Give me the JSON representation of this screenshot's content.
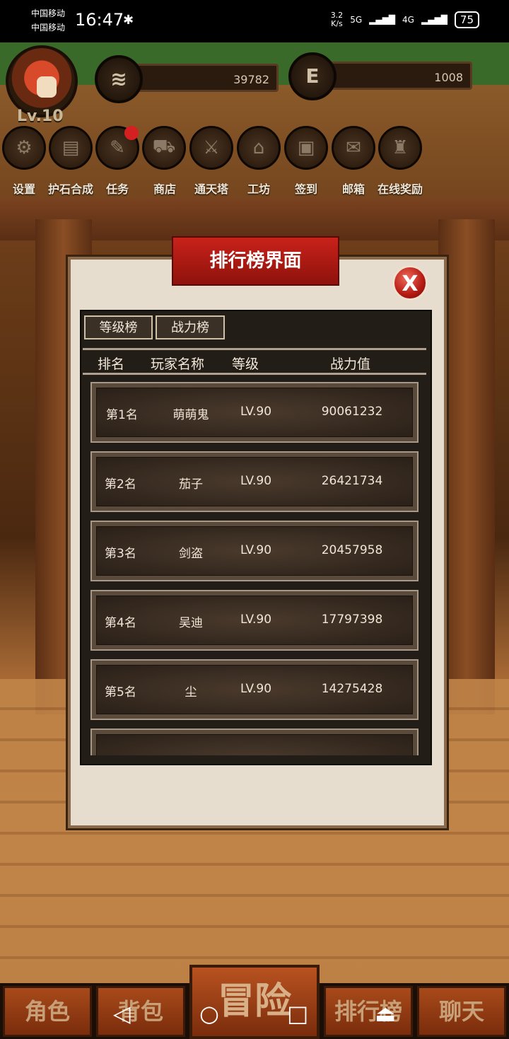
{
  "status_bar": {
    "carrier_1": "中国移动",
    "carrier_2": "中国移动",
    "time": "16:47",
    "net_speed_value": "3.2",
    "net_speed_unit": "K/s",
    "signal_1": "5G",
    "signal_2": "4G",
    "battery": "75"
  },
  "player": {
    "level": "Lv.10",
    "coins": "39782",
    "energy": "1008",
    "energy_icon": "E"
  },
  "menu": [
    {
      "label": "设置",
      "icon": "gear-icon"
    },
    {
      "label": "护石合成",
      "icon": "book-icon"
    },
    {
      "label": "任务",
      "icon": "scroll-icon"
    },
    {
      "label": "商店",
      "icon": "cart-icon"
    },
    {
      "label": "通天塔",
      "icon": "sword-icon"
    },
    {
      "label": "工坊",
      "icon": "house-icon"
    },
    {
      "label": "签到",
      "icon": "chest-icon"
    },
    {
      "label": "邮箱",
      "icon": "mail-icon"
    },
    {
      "label": "在线奖励",
      "icon": "bag-icon"
    }
  ],
  "dialog": {
    "title": "排行榜界面",
    "close_label": "X",
    "tabs": [
      "等级榜",
      "战力榜"
    ],
    "columns": [
      "排名",
      "玩家名称",
      "等级",
      "战力值"
    ],
    "rows": [
      {
        "rank": "第1名",
        "name": "萌萌鬼",
        "level": "LV.90",
        "power": "90061232"
      },
      {
        "rank": "第2名",
        "name": "茄子",
        "level": "LV.90",
        "power": "26421734"
      },
      {
        "rank": "第3名",
        "name": "剑盗",
        "level": "LV.90",
        "power": "20457958"
      },
      {
        "rank": "第4名",
        "name": "吴迪",
        "level": "LV.90",
        "power": "17797398"
      },
      {
        "rank": "第5名",
        "name": "尘",
        "level": "LV.90",
        "power": "14275428"
      }
    ]
  },
  "bottom_nav": {
    "role": "角色",
    "bag": "背包",
    "adventure": "冒险",
    "rank": "排行榜",
    "chat": "聊天"
  },
  "colors": {
    "title_red": "#c8221a",
    "panel_dark": "#231d17",
    "dialog_bg": "#e7ddcf"
  }
}
